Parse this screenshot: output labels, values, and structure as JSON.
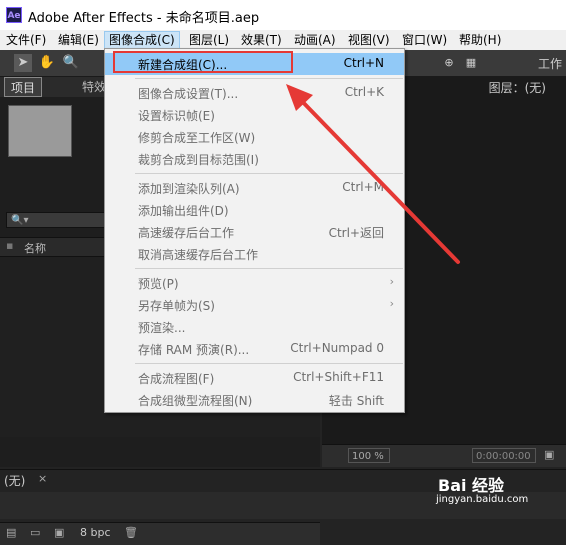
{
  "window": {
    "app_icon": "Ae",
    "title": "Adobe After Effects - 未命名项目.aep"
  },
  "menubar": {
    "items": [
      {
        "label": "文件(F)"
      },
      {
        "label": "编辑(E)"
      },
      {
        "label": "图像合成(C)"
      },
      {
        "label": "图层(L)"
      },
      {
        "label": "效果(T)"
      },
      {
        "label": "动画(A)"
      },
      {
        "label": "视图(V)"
      },
      {
        "label": "窗口(W)"
      },
      {
        "label": "帮助(H)"
      }
    ]
  },
  "toolbar": {
    "workspace_label": "工作"
  },
  "project_panel": {
    "tab_project": "项目",
    "tab_effects": "特效",
    "col_name": "名称",
    "bpc": "8 bpc"
  },
  "viewer_panel": {
    "layer_tab": "图层：(无)",
    "zoom": "100 %",
    "timecode": "0:00:00:00"
  },
  "timeline": {
    "tab": "(无)",
    "close": "×"
  },
  "dropdown": {
    "items": [
      {
        "label": "新建合成组(C)...",
        "shortcut": "Ctrl+N"
      },
      {
        "label": "图像合成设置(T)...",
        "shortcut": "Ctrl+K"
      },
      {
        "label": "设置标识帧(E)",
        "shortcut": ""
      },
      {
        "label": "修剪合成至工作区(W)",
        "shortcut": ""
      },
      {
        "label": "裁剪合成到目标范围(I)",
        "shortcut": ""
      },
      {
        "label": "添加到渲染队列(A)",
        "shortcut": "Ctrl+M"
      },
      {
        "label": "添加输出组件(D)",
        "shortcut": ""
      },
      {
        "label": "高速缓存后台工作",
        "shortcut": "Ctrl+返回"
      },
      {
        "label": "取消高速缓存后台工作",
        "shortcut": ""
      },
      {
        "label": "预览(P)",
        "shortcut": ""
      },
      {
        "label": "另存单帧为(S)",
        "shortcut": ""
      },
      {
        "label": "预渲染...",
        "shortcut": ""
      },
      {
        "label": "存储 RAM 预演(R)...",
        "shortcut": "Ctrl+Numpad 0"
      },
      {
        "label": "合成流程图(F)",
        "shortcut": "Ctrl+Shift+F11"
      },
      {
        "label": "合成组微型流程图(N)",
        "shortcut": "轻击 Shift"
      }
    ]
  },
  "watermark": {
    "brand": "Bai 经验",
    "url": "jingyan.baidu.com"
  }
}
